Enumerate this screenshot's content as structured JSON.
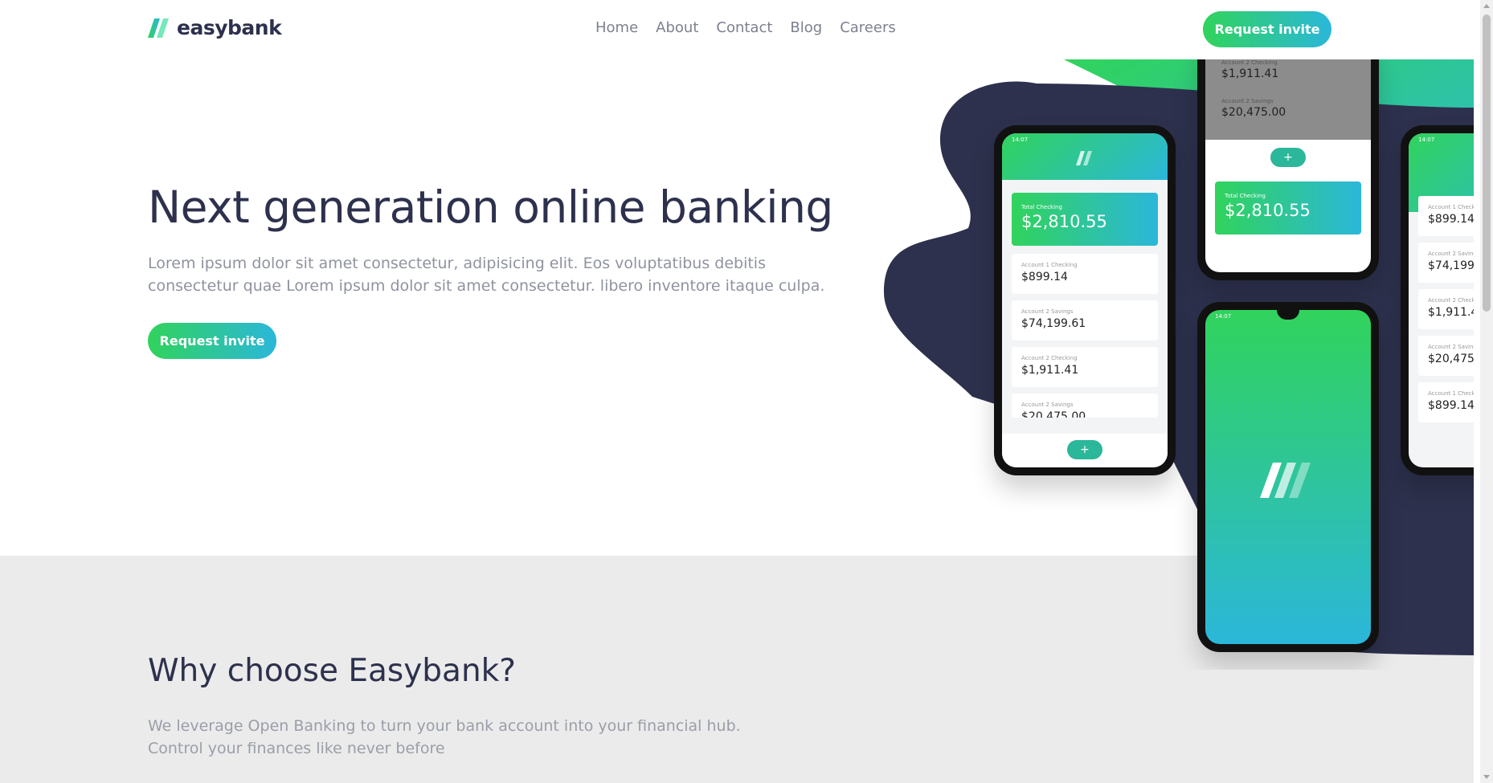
{
  "brand": {
    "name": "easybank"
  },
  "nav": [
    "Home",
    "About",
    "Contact",
    "Blog",
    "Careers"
  ],
  "header_cta": "Request invite",
  "hero": {
    "title": "Next generation online banking",
    "text": "Lorem ipsum dolor sit amet consectetur, adipisicing elit. Eos voluptatibus debitis consectetur quae Lorem ipsum dolor sit amet consectetur. libero inventore itaque culpa.",
    "cta": "Request invite"
  },
  "why": {
    "title": "Why choose Easybank?",
    "line1": "We leverage Open Banking to turn your bank account into your financial hub.",
    "line2": "Control your finances like never before"
  },
  "phones": {
    "time": "14:07",
    "total_label": "Total Checking",
    "total_value": "$2,810.55",
    "accounts": [
      {
        "label": "Account 1 Checking",
        "value": "$899.14"
      },
      {
        "label": "Account 2 Savings",
        "value": "$74,199.61"
      },
      {
        "label": "Account 2 Checking",
        "value": "$1,911.41"
      },
      {
        "label": "Account 2 Savings",
        "value": "$20,475.00"
      }
    ]
  },
  "colors": {
    "primary_green": "#31d35c",
    "primary_cyan": "#2bb7da",
    "navy": "#2d314d",
    "blob": "#2d314d",
    "section_gray": "#ebebeb"
  }
}
